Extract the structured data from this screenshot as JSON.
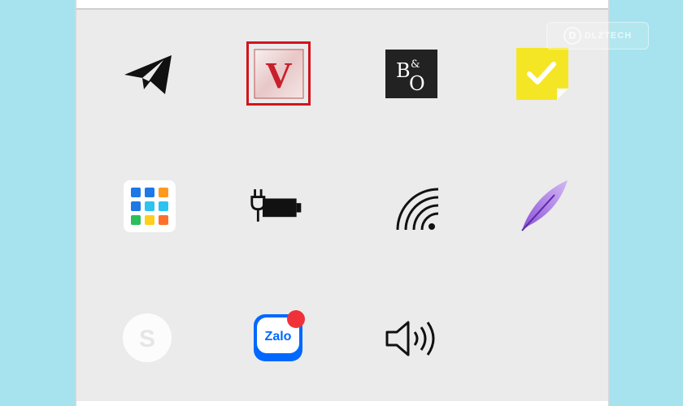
{
  "tray": {
    "selected_index": 1,
    "accent_color": "#d2141c",
    "icons": [
      {
        "name": "telegram-icon",
        "row": 1,
        "col": 1
      },
      {
        "name": "app-v-icon",
        "row": 1,
        "col": 2,
        "label": "V",
        "selected": true
      },
      {
        "name": "bang-olufsen-icon",
        "row": 1,
        "col": 3,
        "label_top": "B",
        "label_amp": "&",
        "label_bottom": "O"
      },
      {
        "name": "sticky-notes-check-icon",
        "row": 1,
        "col": 4
      },
      {
        "name": "app-grid-icon",
        "row": 2,
        "col": 1
      },
      {
        "name": "battery-charging-icon",
        "row": 2,
        "col": 2
      },
      {
        "name": "wifi-icon",
        "row": 2,
        "col": 3
      },
      {
        "name": "feather-quill-icon",
        "row": 2,
        "col": 4
      },
      {
        "name": "skype-icon",
        "row": 3,
        "col": 1,
        "label": "S"
      },
      {
        "name": "zalo-icon",
        "row": 3,
        "col": 2,
        "label": "Zalo",
        "has_notification": true
      },
      {
        "name": "volume-icon",
        "row": 3,
        "col": 3
      }
    ]
  },
  "watermark": {
    "logo_letter": "D",
    "text": "DLZTECH"
  }
}
